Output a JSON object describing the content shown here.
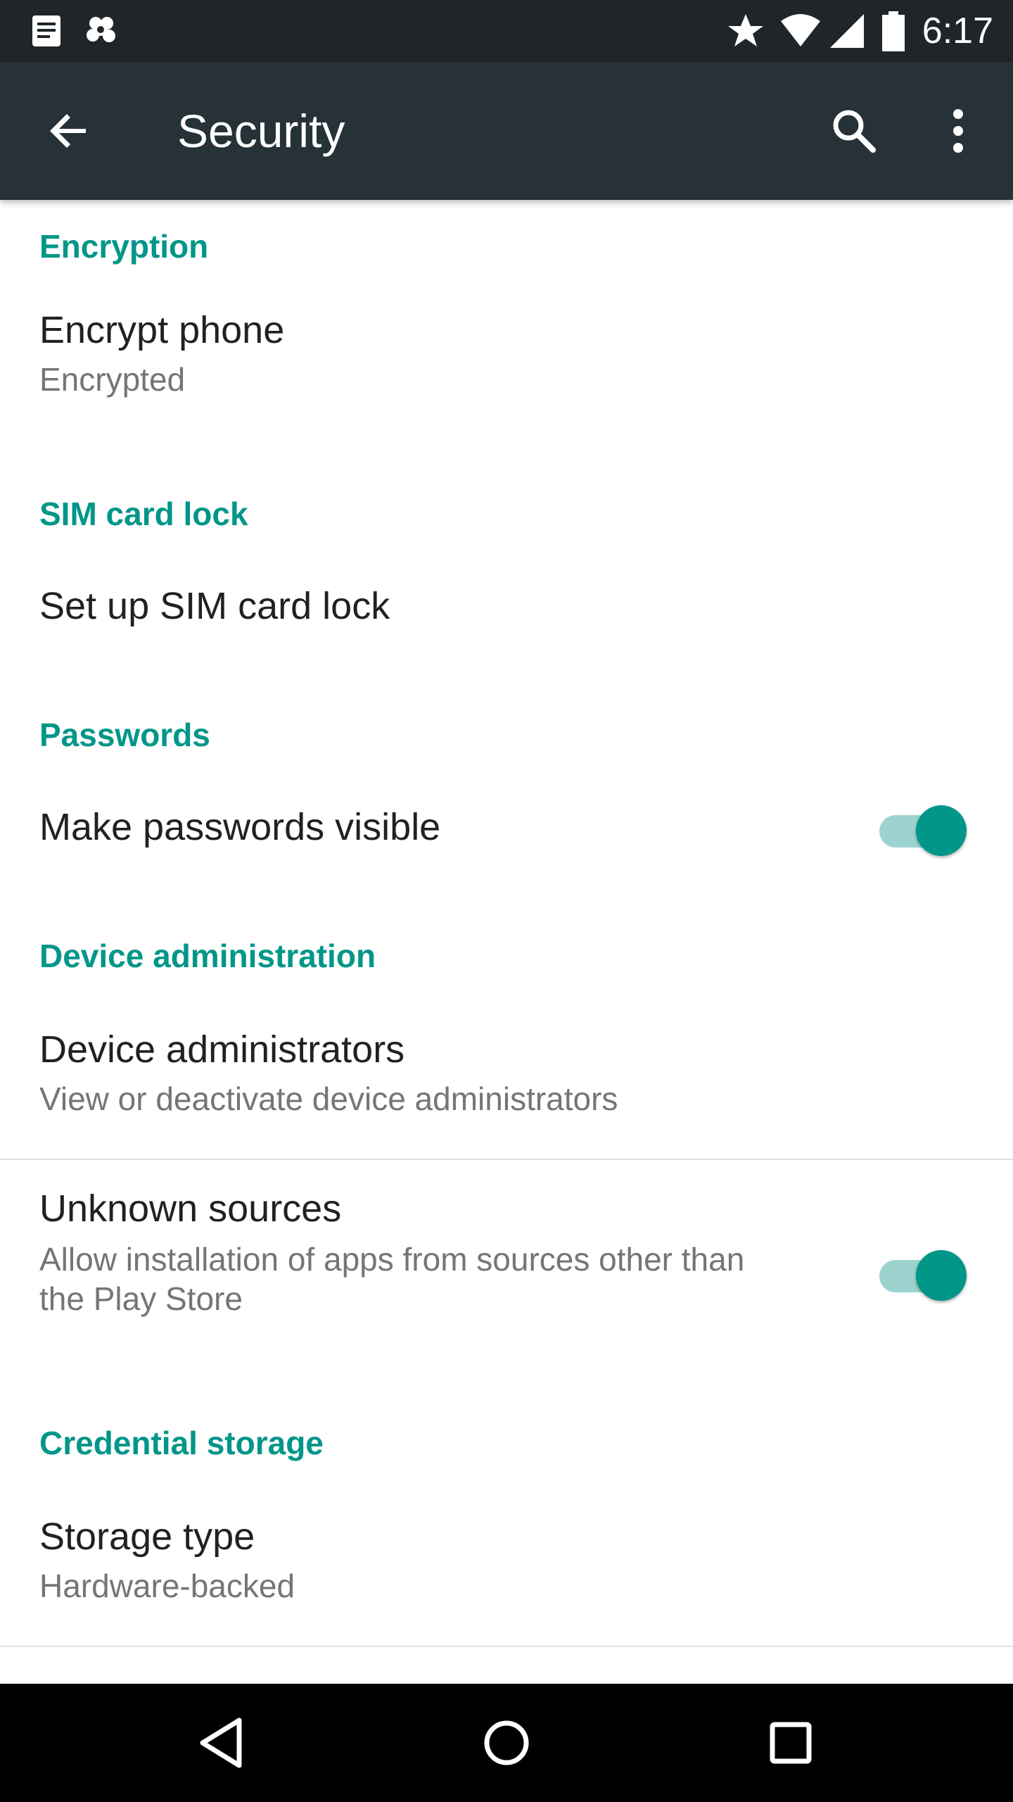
{
  "status_bar": {
    "time": "6:17",
    "left_icons": [
      "notes-notification-icon",
      "settings-notification-icon"
    ],
    "right_icons": [
      "star-icon",
      "wifi-icon",
      "cellular-signal-icon",
      "battery-icon"
    ]
  },
  "toolbar": {
    "title": "Security",
    "back_icon": "arrow-back-icon",
    "search_icon": "search-icon",
    "more_icon": "more-vert-icon"
  },
  "sections": {
    "encryption": {
      "header": "Encryption",
      "encrypt_phone": {
        "title": "Encrypt phone",
        "summary": "Encrypted"
      }
    },
    "sim_card_lock": {
      "header": "SIM card lock",
      "set_up": {
        "title": "Set up SIM card lock"
      }
    },
    "passwords": {
      "header": "Passwords",
      "make_visible": {
        "title": "Make passwords visible",
        "enabled": true
      }
    },
    "device_administration": {
      "header": "Device administration",
      "administrators": {
        "title": "Device administrators",
        "summary": "View or deactivate device administrators"
      },
      "unknown_sources": {
        "title": "Unknown sources",
        "summary_line1": "Allow installation of apps from sources other than",
        "summary_line2": "the Play Store",
        "enabled": true
      }
    },
    "credential_storage": {
      "header": "Credential storage",
      "storage_type": {
        "title": "Storage type",
        "summary": "Hardware-backed"
      }
    }
  },
  "colors": {
    "status_bar": "#1f2529",
    "toolbar": "#263238",
    "accent": "#009688",
    "switch_track": "#9cd3cf",
    "primary_text": "#212121",
    "secondary_text": "#757575",
    "nav_bar": "#000000"
  },
  "nav_bar": {
    "back_icon": "nav-back-icon",
    "home_icon": "nav-home-icon",
    "recents_icon": "nav-recents-icon"
  }
}
